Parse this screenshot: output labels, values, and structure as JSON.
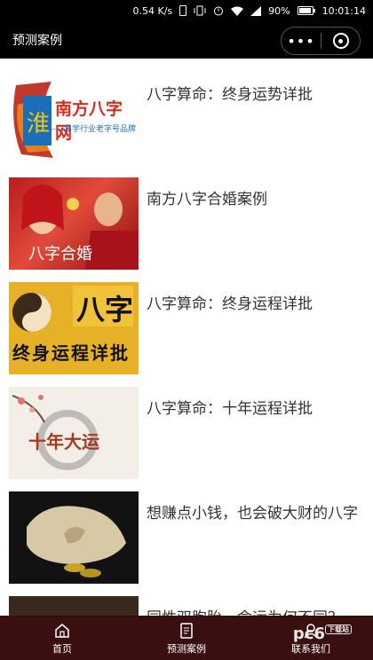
{
  "status": {
    "speed": "0.54 K/s",
    "battery": "90%",
    "time": "10:01:14"
  },
  "header": {
    "title": "预测案例",
    "more_label": "•••"
  },
  "cases": [
    {
      "title": "八字算命：终身运势详批",
      "thumb_text": "南方八字网",
      "thumb_sub": "——易学行业老字号品牌"
    },
    {
      "title": "南方八字合婚案例",
      "thumb_text": "八字合婚"
    },
    {
      "title": "八字算命：终身运程详批",
      "thumb_text": "八字",
      "thumb_sub": "终身运程详批"
    },
    {
      "title": "八字算命：十年运程详批",
      "thumb_text": "十年大运"
    },
    {
      "title": "想赚点小钱，也会破大财的八字"
    },
    {
      "title": "同性双胞胎，命运为何不同？"
    }
  ],
  "tabs": [
    {
      "label": "首页"
    },
    {
      "label": "预测案例"
    },
    {
      "label": "联系我们"
    }
  ],
  "watermark": {
    "text": "pc6",
    "badge": "下载站"
  }
}
